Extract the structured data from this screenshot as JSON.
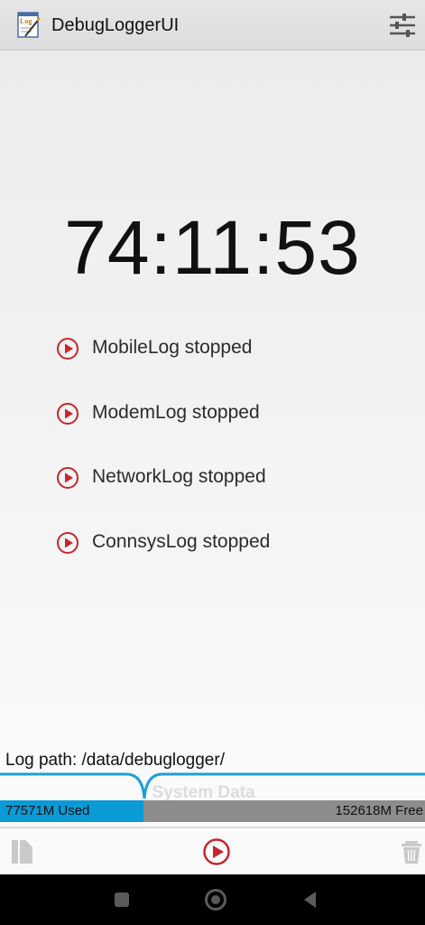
{
  "app_bar": {
    "title": "DebugLoggerUI",
    "app_icon": "log-notepad-icon",
    "settings_icon": "sliders-icon"
  },
  "main": {
    "timer": "74:11:53",
    "logs": [
      {
        "label": "MobileLog stopped",
        "icon": "play-circle-icon"
      },
      {
        "label": "ModemLog stopped",
        "icon": "play-circle-icon"
      },
      {
        "label": "NetworkLog stopped",
        "icon": "play-circle-icon"
      },
      {
        "label": "ConnsysLog stopped",
        "icon": "play-circle-icon"
      }
    ],
    "log_path": "Log path: /data/debuglogger/"
  },
  "storage": {
    "label": "System Data",
    "used": "77571M Used",
    "free": "152618M Free",
    "used_fraction": 0.337,
    "used_color": "#0a9ad6",
    "free_color": "#8c8c8c"
  },
  "toolbar": {
    "left_icon": "log-file-icon",
    "center_icon": "play-circle-icon",
    "right_icon": "trash-icon"
  },
  "nav": {
    "items": [
      "recents-square-icon",
      "home-circle-icon",
      "back-triangle-icon"
    ]
  },
  "colors": {
    "accent_red": "#c8252c",
    "storage_blue": "#0a9ad6"
  }
}
